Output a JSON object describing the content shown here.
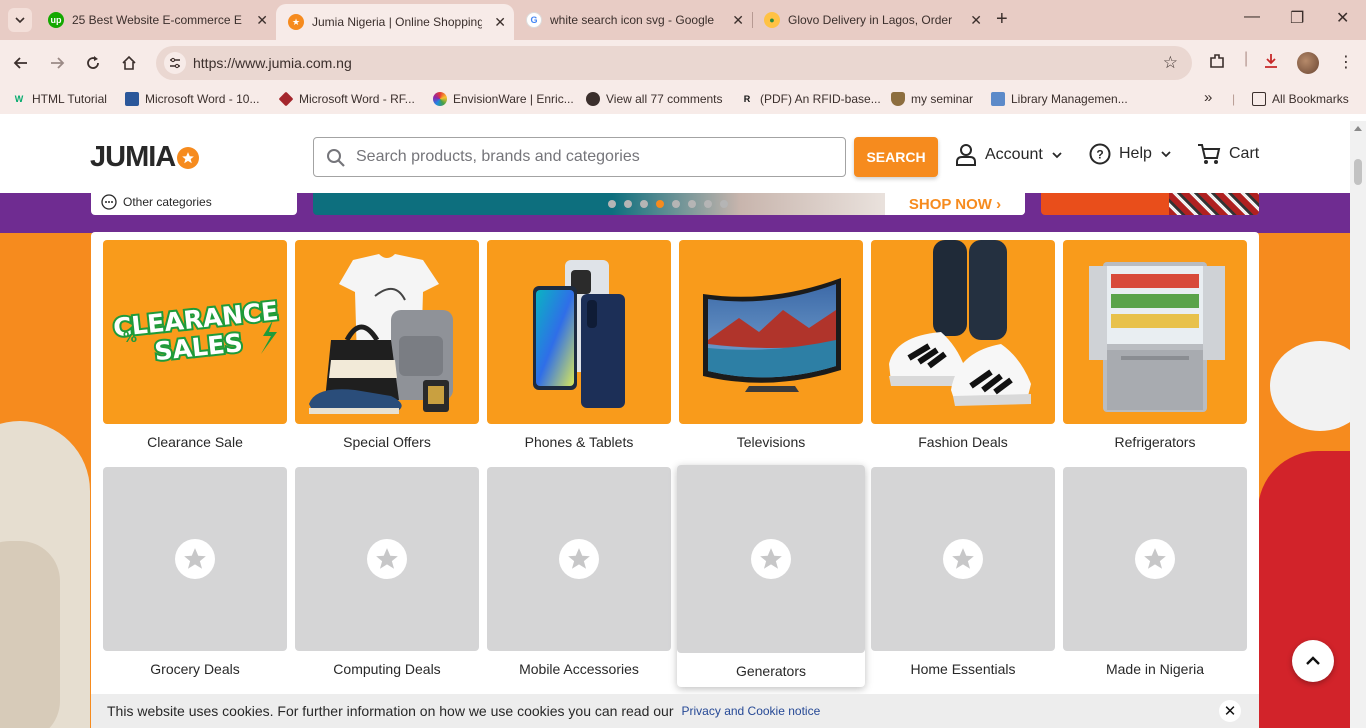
{
  "browser": {
    "tabs": [
      {
        "title": "25 Best Website E-commerce E",
        "favicon": "upwork-icon",
        "color": "#14a800"
      },
      {
        "title": "Jumia Nigeria | Online Shopping",
        "favicon": "jumia-star-icon",
        "color": "#f68b1e",
        "active": true
      },
      {
        "title": "white search icon svg - Google",
        "favicon": "google-icon",
        "color": "#4285f4"
      },
      {
        "title": "Glovo Delivery in Lagos, Order",
        "favicon": "map-pin-icon",
        "color": "#ffc244"
      }
    ],
    "url": "https://www.jumia.com.ng",
    "bookmarks": [
      {
        "label": "HTML Tutorial",
        "icon": "w3-icon"
      },
      {
        "label": "Microsoft Word - 10...",
        "icon": "grid-icon"
      },
      {
        "label": "Microsoft Word - RF...",
        "icon": "diamond-icon"
      },
      {
        "label": "EnvisionWare | Enric...",
        "icon": "pinwheel-icon"
      },
      {
        "label": "View all 77 comments",
        "icon": "globe-icon"
      },
      {
        "label": "(PDF) An RFID-base...",
        "icon": "researchgate-icon"
      },
      {
        "label": "my seminar",
        "icon": "crest-icon"
      },
      {
        "label": "Library Managemen...",
        "icon": "library-icon"
      }
    ],
    "all_bookmarks": "All Bookmarks"
  },
  "header": {
    "logo_text": "JUMIA",
    "search_placeholder": "Search products, brands and categories",
    "search_button": "SEARCH",
    "account": "Account",
    "help": "Help",
    "cart": "Cart"
  },
  "hero": {
    "other_categories": "Other categories",
    "shop_now": "SHOP NOW ›",
    "slide_count": 8,
    "active_slide": 4
  },
  "categories": [
    {
      "label": "Clearance Sale",
      "image": "clearance-sales"
    },
    {
      "label": "Special Offers",
      "image": "bags-shirt"
    },
    {
      "label": "Phones & Tablets",
      "image": "phones"
    },
    {
      "label": "Televisions",
      "image": "tv"
    },
    {
      "label": "Fashion Deals",
      "image": "sneakers"
    },
    {
      "label": "Refrigerators",
      "image": "fridge"
    },
    {
      "label": "Grocery Deals",
      "image": "placeholder"
    },
    {
      "label": "Computing Deals",
      "image": "placeholder"
    },
    {
      "label": "Mobile Accessories",
      "image": "placeholder"
    },
    {
      "label": "Generators",
      "image": "placeholder"
    },
    {
      "label": "Home Essentials",
      "image": "placeholder"
    },
    {
      "label": "Made in Nigeria",
      "image": "placeholder"
    }
  ],
  "clearance_banner": {
    "line1": "CLEARANCE",
    "line2": "SALES"
  },
  "cookie": {
    "text": "This website uses cookies. For further information on how we use cookies you can read our",
    "link": "Privacy and Cookie notice"
  },
  "colors": {
    "brand_orange": "#f68b1e",
    "purple": "#6f2c91",
    "tile_orange": "#f99b1b"
  }
}
